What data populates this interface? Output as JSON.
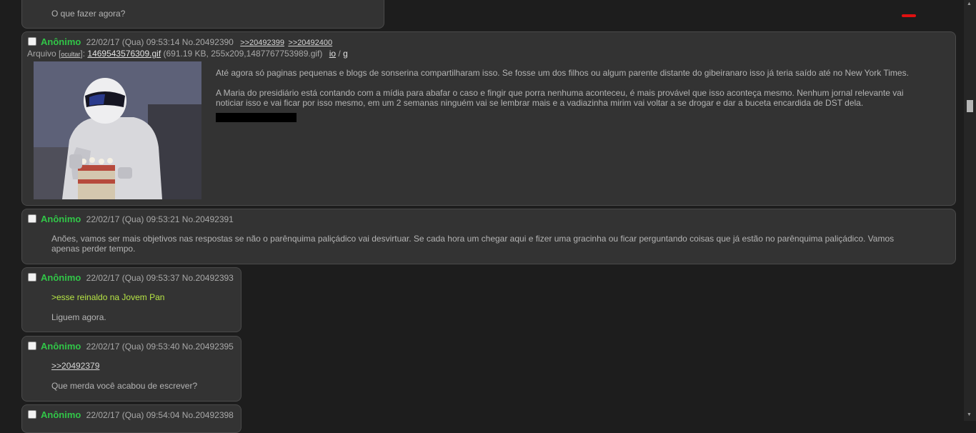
{
  "posts": [
    {
      "message": "O que fazer agora?"
    },
    {
      "name": "Anônimo",
      "date": "22/02/17 (Qua) 09:53:14",
      "number": "No.20492390",
      "replies": [
        ">>20492399",
        ">>20492400"
      ],
      "file": {
        "label": "Arquivo",
        "hide": "ocultar",
        "filename": "1469543576309.gif",
        "meta": "(691.19 KB, 255x209,1487767753989.gif)",
        "link1": "io",
        "sep": "/",
        "link2": "g"
      },
      "paragraphs": [
        "Até agora só paginas pequenas e blogs de sonserina compartilharam isso. Se fosse um dos filhos ou algum parente distante do gibeiranaro isso já teria saído até no New York Times.",
        "A Maria do presidiário está contando com a mídia para abafar o caso e fingir que porra nenhuma aconteceu, é mais provável que isso aconteça mesmo. Nenhum jornal relevante vai noticiar isso e vai ficar por isso mesmo, em um 2 semanas ninguém vai se lembrar mais e a vadiazinha mirim vai voltar a se drogar e dar a buceta encardida de DST dela."
      ]
    },
    {
      "name": "Anônimo",
      "date": "22/02/17 (Qua) 09:53:21",
      "number": "No.20492391",
      "message": "Anões, vamos ser mais objetivos nas respostas se não o parênquima paliçádico vai desvirtuar. Se cada hora um chegar aqui e fizer uma gracinha ou ficar perguntando coisas que já estão no parênquima paliçádico. Vamos apenas perder tempo."
    },
    {
      "name": "Anônimo",
      "date": "22/02/17 (Qua) 09:53:37",
      "number": "No.20492393",
      "greentext": ">esse reinaldo na Jovem Pan",
      "message": "Liguem agora."
    },
    {
      "name": "Anônimo",
      "date": "22/02/17 (Qua) 09:53:40",
      "number": "No.20492395",
      "quote": ">>20492379",
      "message": "Que merda você acabou de escrever?"
    },
    {
      "name": "Anônimo",
      "date": "22/02/17 (Qua) 09:54:04",
      "number": "No.20492398"
    }
  ],
  "colors": {
    "name": "#31c648",
    "greentext": "#b6e445",
    "post_bg": "#333333",
    "page_bg": "#1d1d1d"
  }
}
